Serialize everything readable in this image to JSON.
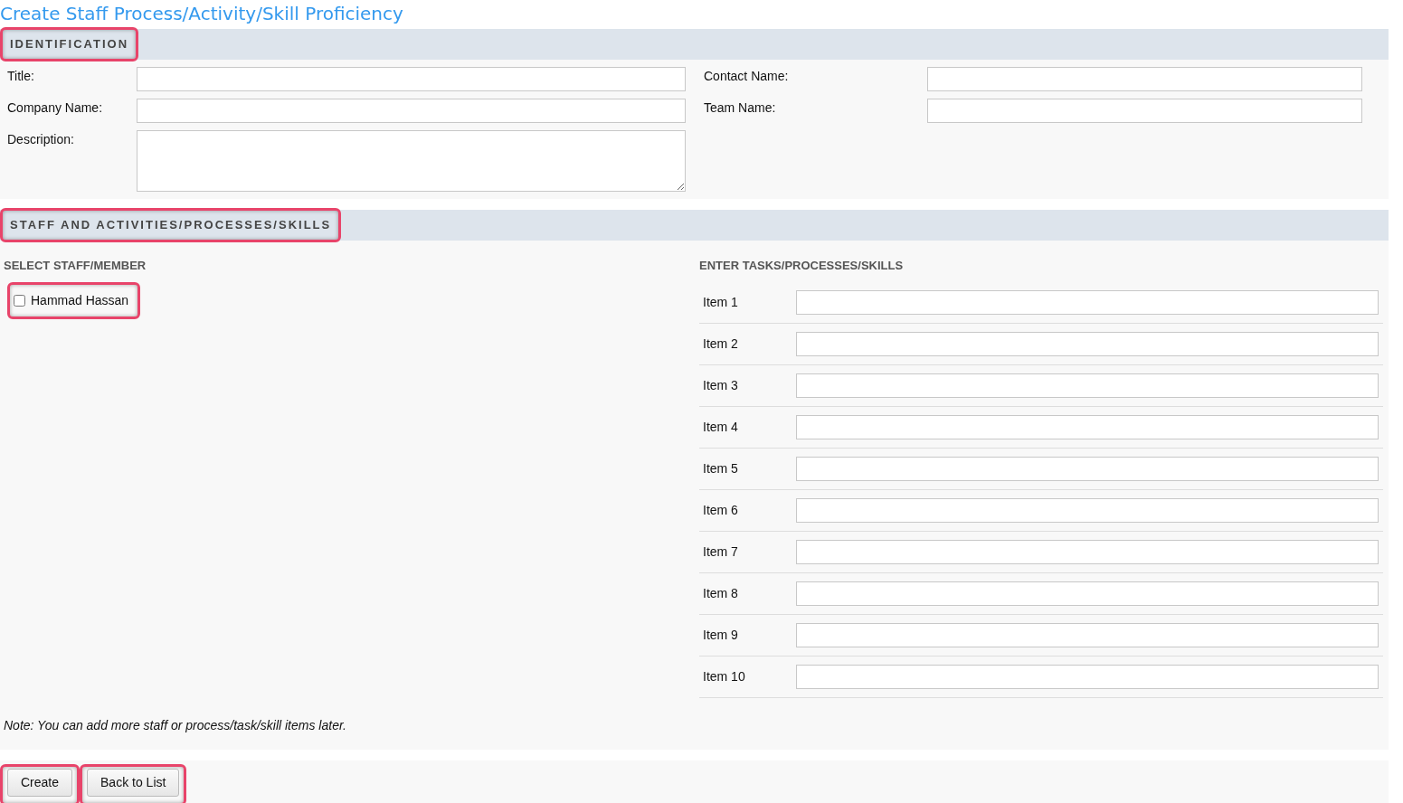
{
  "page_title": "Create Staff Process/Activity/Skill Proficiency",
  "identification": {
    "header": {
      "label": "IDENTIFICATION",
      "highlighted": true
    },
    "left_fields": [
      {
        "label": "Title:",
        "kind": "text"
      },
      {
        "label": "Company Name:",
        "kind": "text"
      },
      {
        "label": "Description:",
        "kind": "textarea"
      }
    ],
    "right_fields": [
      {
        "label": "Contact Name:",
        "kind": "text"
      },
      {
        "label": "Team Name:",
        "kind": "text"
      }
    ]
  },
  "staff_section": {
    "header": {
      "label": "STAFF AND ACTIVITIES/PROCESSES/SKILLS",
      "highlighted": true
    },
    "staff_heading": "SELECT STAFF/MEMBER",
    "staff": [
      {
        "name": "Hammad Hassan",
        "checked": false,
        "highlighted": true
      }
    ],
    "items_heading": "ENTER TASKS/PROCESSES/SKILLS",
    "items": [
      {
        "label": "Item 1"
      },
      {
        "label": "Item 2"
      },
      {
        "label": "Item 3"
      },
      {
        "label": "Item 4"
      },
      {
        "label": "Item 5"
      },
      {
        "label": "Item 6"
      },
      {
        "label": "Item 7"
      },
      {
        "label": "Item 8"
      },
      {
        "label": "Item 9"
      },
      {
        "label": "Item 10"
      }
    ],
    "note": "Note: You can add more staff or process/task/skill items later."
  },
  "buttons": [
    {
      "label": "Create",
      "highlighted": true
    },
    {
      "label": "Back to List",
      "highlighted": true
    }
  ]
}
